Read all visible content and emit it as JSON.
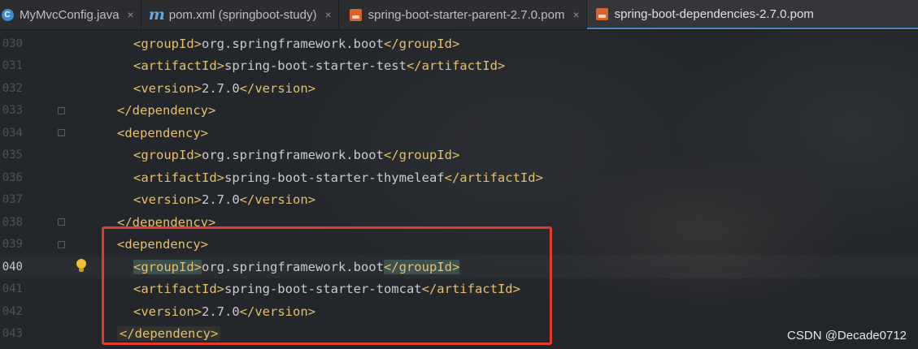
{
  "tabs": [
    {
      "label": "MyMvcConfig.java",
      "icon": "java-class-icon",
      "close": "×",
      "active": false
    },
    {
      "label": "pom.xml (springboot-study)",
      "icon": "maven-icon",
      "close": "×",
      "active": false
    },
    {
      "label": "spring-boot-starter-parent-2.7.0.pom",
      "icon": "pom-file-icon",
      "close": "×",
      "active": false
    },
    {
      "label": "spring-boot-dependencies-2.7.0.pom",
      "icon": "pom-file-icon",
      "close": "",
      "active": true
    }
  ],
  "editor": {
    "current_line": "040",
    "lines": [
      {
        "num": "030",
        "open": "<groupId>",
        "value": "org.springframework.boot",
        "close": "</groupId>"
      },
      {
        "num": "031",
        "open": "<artifactId>",
        "value": "spring-boot-starter-test",
        "close": "</artifactId>"
      },
      {
        "num": "032",
        "open": "<version>",
        "value": "2.7.0",
        "close": "</version>"
      },
      {
        "num": "033",
        "open": "</dependency>",
        "value": "",
        "close": ""
      },
      {
        "num": "034",
        "open": "<dependency>",
        "value": "",
        "close": ""
      },
      {
        "num": "035",
        "open": "<groupId>",
        "value": "org.springframework.boot",
        "close": "</groupId>"
      },
      {
        "num": "036",
        "open": "<artifactId>",
        "value": "spring-boot-starter-thymeleaf",
        "close": "</artifactId>"
      },
      {
        "num": "037",
        "open": "<version>",
        "value": "2.7.0",
        "close": "</version>"
      },
      {
        "num": "038",
        "open": "</dependency>",
        "value": "",
        "close": ""
      },
      {
        "num": "039",
        "open": "<dependency>",
        "value": "",
        "close": ""
      },
      {
        "num": "040",
        "open": "<groupId>",
        "value": "org.springframework.boot",
        "close": "</groupId>"
      },
      {
        "num": "041",
        "open": "<artifactId>",
        "value": "spring-boot-starter-tomcat",
        "close": "</artifactId>"
      },
      {
        "num": "042",
        "open": "<version>",
        "value": "2.7.0",
        "close": "</version>"
      },
      {
        "num": "043",
        "open": "</dependency>",
        "value": "",
        "close": ""
      }
    ]
  },
  "annotation": {
    "color": "#e33a2f"
  },
  "watermark": "CSDN @Decade0712"
}
